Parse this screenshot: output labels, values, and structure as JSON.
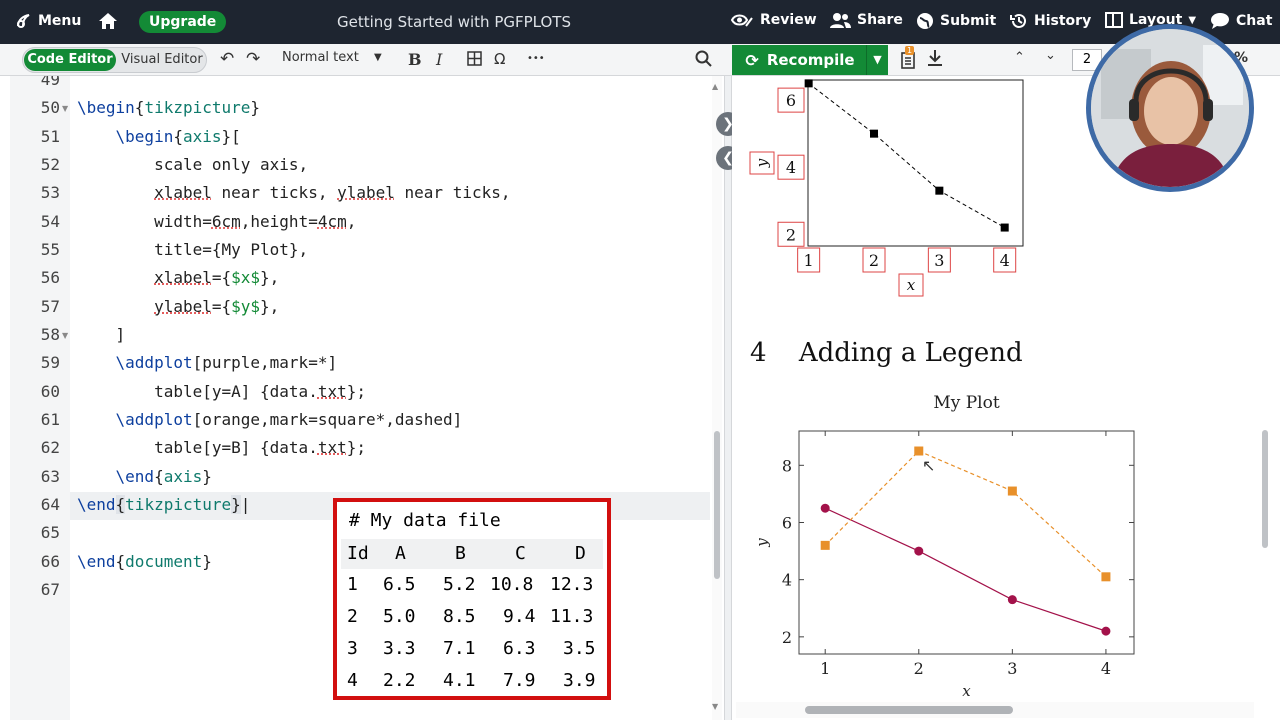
{
  "topbar": {
    "menu": "Menu",
    "upgrade": "Upgrade",
    "project_title": "Getting Started with PGFPLOTS",
    "review": "Review",
    "share": "Share",
    "submit": "Submit",
    "history": "History",
    "layout": "Layout",
    "chat": "Chat"
  },
  "toolbar": {
    "code_editor": "Code Editor",
    "visual_editor": "Visual Editor",
    "text_style": "Normal text",
    "bold": "B",
    "italic": "I",
    "omega": "Ω",
    "more": "•••",
    "recompile": "Recompile",
    "page_number": "2",
    "badge": "1",
    "zoom_suffix": "%"
  },
  "editor": {
    "line_numbers": [
      "49",
      "50",
      "51",
      "52",
      "53",
      "54",
      "55",
      "56",
      "57",
      "58",
      "59",
      "60",
      "61",
      "62",
      "63",
      "64",
      "65",
      "66",
      "67"
    ]
  },
  "data_table": {
    "title": "# My data file",
    "headers": [
      "Id",
      "A",
      "B",
      "C",
      "D"
    ],
    "rows": [
      [
        "1",
        "6.5",
        "5.2",
        "10.8",
        "12.3"
      ],
      [
        "2",
        "5.0",
        "8.5",
        "9.4",
        "11.3"
      ],
      [
        "3",
        "3.3",
        "7.1",
        "6.3",
        "3.5"
      ],
      [
        "4",
        "2.2",
        "4.1",
        "7.9",
        "3.9"
      ]
    ]
  },
  "pdf": {
    "section_number": "4",
    "section_title": "Adding a Legend",
    "plot_title": "My Plot"
  },
  "chart_data": [
    {
      "type": "line",
      "title": "",
      "xlabel": "x",
      "ylabel": "y",
      "x": [
        1,
        2,
        3,
        4
      ],
      "xticks": [
        "1",
        "2",
        "3",
        "4"
      ],
      "yticks": [
        "2",
        "4",
        "6"
      ],
      "series": [
        {
          "values": [
            6.5,
            5.0,
            3.3,
            2.2
          ],
          "color": "#000000",
          "style": "dashed",
          "marker": "square"
        }
      ]
    },
    {
      "type": "line",
      "title": "My Plot",
      "xlabel": "x",
      "ylabel": "y",
      "x": [
        1,
        2,
        3,
        4
      ],
      "xticks": [
        "1",
        "2",
        "3",
        "4"
      ],
      "yticks": [
        "2",
        "4",
        "6",
        "8"
      ],
      "ylim": [
        1.4,
        9.2
      ],
      "series": [
        {
          "values": [
            6.5,
            5.0,
            3.3,
            2.2
          ],
          "color": "#a3124a",
          "style": "solid",
          "marker": "circle"
        },
        {
          "values": [
            5.2,
            8.5,
            7.1,
            4.1
          ],
          "color": "#e8902a",
          "style": "dashed",
          "marker": "square"
        }
      ]
    }
  ],
  "colors": {
    "accent": "#138a36",
    "topbar": "#1e2530",
    "highlight": "#d20f0f"
  }
}
